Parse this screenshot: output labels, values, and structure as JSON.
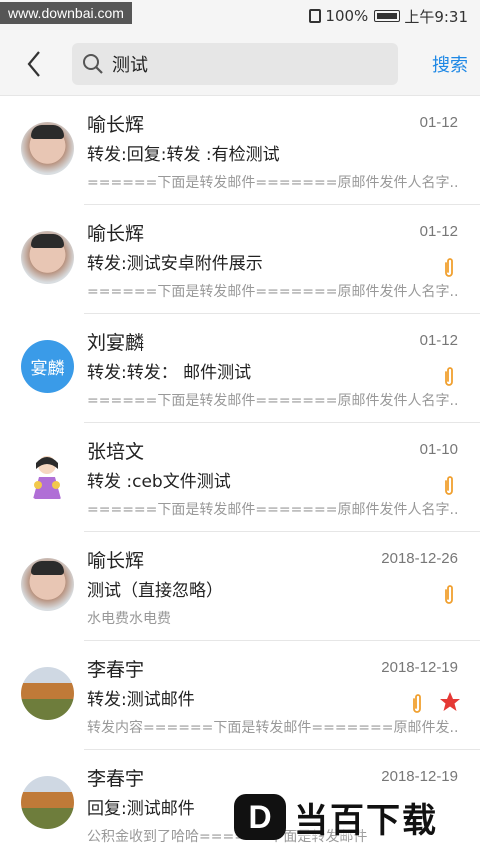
{
  "watermark_top": "www.downbai.com",
  "status": {
    "battery": "100%",
    "time": "上午9:31"
  },
  "search": {
    "query": "测试",
    "action": "搜索"
  },
  "mails": [
    {
      "sender": "喻长辉",
      "date": "01-12",
      "subject": "转发:回复:转发 :有检测试",
      "preview": "======下面是转发邮件=======原邮件发件人名字...",
      "attachment": false,
      "starred": false,
      "avatar": "face"
    },
    {
      "sender": "喻长辉",
      "date": "01-12",
      "subject": "转发:测试安卓附件展示",
      "preview": "======下面是转发邮件=======原邮件发件人名字...",
      "attachment": true,
      "starred": false,
      "avatar": "face"
    },
    {
      "sender": "刘宴麟",
      "date": "01-12",
      "subject": "转发:转发： 邮件测试",
      "preview": "======下面是转发邮件=======原邮件发件人名字...",
      "attachment": true,
      "starred": false,
      "avatar": "text",
      "avatar_text": "宴麟"
    },
    {
      "sender": "张培文",
      "date": "01-10",
      "subject": "转发 :ceb文件测试",
      "preview": "======下面是转发邮件=======原邮件发件人名字...",
      "attachment": true,
      "starred": false,
      "avatar": "cartoon"
    },
    {
      "sender": "喻长辉",
      "date": "2018-12-26",
      "subject": "测试（直接忽略）",
      "preview": "水电费水电费",
      "attachment": true,
      "starred": false,
      "avatar": "face"
    },
    {
      "sender": "李春宇",
      "date": "2018-12-19",
      "subject": "转发:测试邮件",
      "preview": "转发内容======下面是转发邮件=======原邮件发...",
      "attachment": true,
      "starred": true,
      "avatar": "tree"
    },
    {
      "sender": "李春宇",
      "date": "2018-12-19",
      "subject": "回复:测试邮件",
      "preview": "公积金收到了哈哈======下面是转发邮件",
      "attachment": false,
      "starred": false,
      "avatar": "tree"
    }
  ],
  "brand_watermark": {
    "logo": "D",
    "text": "当百下载"
  },
  "colors": {
    "accent": "#1e88e5",
    "attachment": "#f0a030",
    "star": "#e53935"
  }
}
